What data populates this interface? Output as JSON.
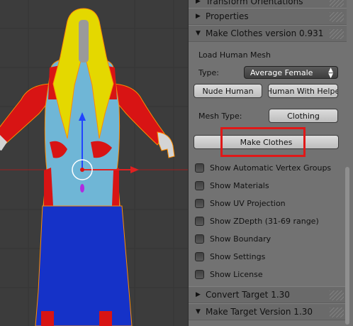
{
  "panel": {
    "transform_orientations": "Transform Orientations",
    "properties": "Properties",
    "make_clothes_title": "Make Clothes version 0.931",
    "load_human_mesh": "Load Human Mesh",
    "type_label": "Type:",
    "type_value": "Average Female",
    "nude_human": "Nude Human",
    "human_with_helpers": "Human With Helpe",
    "mesh_type_label": "Mesh Type:",
    "mesh_type_value": "Clothing",
    "make_clothes_button": "Make Clothes",
    "options": [
      {
        "label": "Show Automatic Vertex Groups",
        "checked": false
      },
      {
        "label": "Show Materials",
        "checked": false
      },
      {
        "label": "Show UV Projection",
        "checked": false
      },
      {
        "label": "Show ZDepth (31-69 range)",
        "checked": false
      },
      {
        "label": "Show Boundary",
        "checked": false
      },
      {
        "label": "Show Settings",
        "checked": false
      },
      {
        "label": "Show License",
        "checked": false
      }
    ],
    "convert_target": "Convert Target 1.30",
    "make_target": "Make Target  Version 1.30"
  },
  "icons": {
    "collapsed": "triangle-right-icon",
    "expanded": "triangle-down-icon",
    "dropdown": "up-down-arrows-icon"
  },
  "colors": {
    "panel_bg": "#727272",
    "viewport_bg": "#3c3c3c",
    "highlight": "#e01818",
    "dress_top": "#6fb6d6",
    "skirt": "#1532c8",
    "sleeves": "#d81414",
    "hair": "#e4d800",
    "selection": "#ff8c00"
  }
}
